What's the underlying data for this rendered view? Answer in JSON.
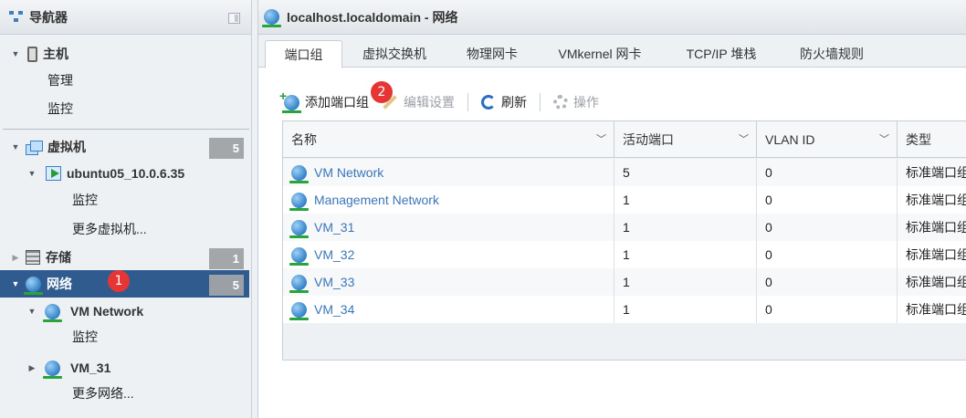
{
  "navigator": {
    "title": "导航器",
    "host": {
      "label": "主机",
      "children": [
        "管理",
        "监控"
      ]
    },
    "vms": {
      "label": "虚拟机",
      "count": "5",
      "vm": {
        "label": "ubuntu05_10.0.6.35",
        "children": [
          "监控",
          "更多虚拟机..."
        ]
      }
    },
    "storage": {
      "label": "存储",
      "count": "1"
    },
    "networking": {
      "label": "网络",
      "count": "5",
      "callout": "1",
      "vm_network": {
        "label": "VM Network",
        "child": "监控"
      },
      "vm31": {
        "label": "VM_31"
      },
      "more": "更多网络..."
    }
  },
  "main": {
    "title": "localhost.localdomain - 网络",
    "tabs": [
      "端口组",
      "虚拟交换机",
      "物理网卡",
      "VMkernel 网卡",
      "TCP/IP 堆栈",
      "防火墙规则"
    ],
    "active_tab": "端口组",
    "toolbar": {
      "add": "添加端口组",
      "edit": "编辑设置",
      "refresh": "刷新",
      "actions": "操作",
      "callout": "2"
    },
    "table": {
      "columns": [
        "名称",
        "活动端口",
        "VLAN ID",
        "类型"
      ],
      "rows": [
        {
          "name": "VM Network",
          "ports": "5",
          "vlan": "0",
          "type": "标准端口组"
        },
        {
          "name": "Management Network",
          "ports": "1",
          "vlan": "0",
          "type": "标准端口组"
        },
        {
          "name": "VM_31",
          "ports": "1",
          "vlan": "0",
          "type": "标准端口组"
        },
        {
          "name": "VM_32",
          "ports": "1",
          "vlan": "0",
          "type": "标准端口组"
        },
        {
          "name": "VM_33",
          "ports": "1",
          "vlan": "0",
          "type": "标准端口组"
        },
        {
          "name": "VM_34",
          "ports": "1",
          "vlan": "0",
          "type": "标准端口组"
        }
      ]
    }
  },
  "colors": {
    "selected": "#2f5b8e",
    "link": "#3a76b8",
    "badge": "#a4a7aa",
    "callout": "#e53535"
  }
}
